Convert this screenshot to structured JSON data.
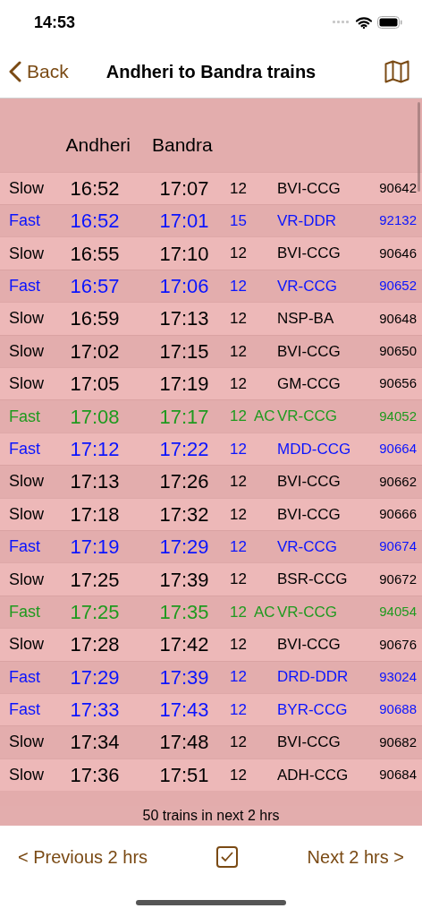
{
  "status_bar": {
    "time": "14:53"
  },
  "nav": {
    "back": "Back",
    "title": "Andheri to Bandra trains"
  },
  "table": {
    "columns": [
      "Andheri",
      "Bandra"
    ],
    "rows": [
      {
        "kind": "slow",
        "type": "Slow",
        "depart": "16:52",
        "arrive": "17:07",
        "cars": "12",
        "route": "BVI-CCG",
        "train": "90642"
      },
      {
        "kind": "fast",
        "type": "Fast",
        "depart": "16:52",
        "arrive": "17:01",
        "cars": "15",
        "route": "VR-DDR",
        "train": "92132"
      },
      {
        "kind": "slow",
        "type": "Slow",
        "depart": "16:55",
        "arrive": "17:10",
        "cars": "12",
        "route": "BVI-CCG",
        "train": "90646"
      },
      {
        "kind": "fast",
        "type": "Fast",
        "depart": "16:57",
        "arrive": "17:06",
        "cars": "12",
        "route": "VR-CCG",
        "train": "90652"
      },
      {
        "kind": "slow",
        "type": "Slow",
        "depart": "16:59",
        "arrive": "17:13",
        "cars": "12",
        "route": "NSP-BA",
        "train": "90648"
      },
      {
        "kind": "slow",
        "type": "Slow",
        "depart": "17:02",
        "arrive": "17:15",
        "cars": "12",
        "route": "BVI-CCG",
        "train": "90650"
      },
      {
        "kind": "slow",
        "type": "Slow",
        "depart": "17:05",
        "arrive": "17:19",
        "cars": "12",
        "route": "GM-CCG",
        "train": "90656"
      },
      {
        "kind": "ac",
        "type": "Fast",
        "depart": "17:08",
        "arrive": "17:17",
        "cars": "12",
        "ac": "AC",
        "route": "VR-CCG",
        "train": "94052"
      },
      {
        "kind": "fast",
        "type": "Fast",
        "depart": "17:12",
        "arrive": "17:22",
        "cars": "12",
        "route": "MDD-CCG",
        "train": "90664"
      },
      {
        "kind": "slow",
        "type": "Slow",
        "depart": "17:13",
        "arrive": "17:26",
        "cars": "12",
        "route": "BVI-CCG",
        "train": "90662"
      },
      {
        "kind": "slow",
        "type": "Slow",
        "depart": "17:18",
        "arrive": "17:32",
        "cars": "12",
        "route": "BVI-CCG",
        "train": "90666"
      },
      {
        "kind": "fast",
        "type": "Fast",
        "depart": "17:19",
        "arrive": "17:29",
        "cars": "12",
        "route": "VR-CCG",
        "train": "90674"
      },
      {
        "kind": "slow",
        "type": "Slow",
        "depart": "17:25",
        "arrive": "17:39",
        "cars": "12",
        "route": "BSR-CCG",
        "train": "90672"
      },
      {
        "kind": "ac",
        "type": "Fast",
        "depart": "17:25",
        "arrive": "17:35",
        "cars": "12",
        "ac": "AC",
        "route": "VR-CCG",
        "train": "94054"
      },
      {
        "kind": "slow",
        "type": "Slow",
        "depart": "17:28",
        "arrive": "17:42",
        "cars": "12",
        "route": "BVI-CCG",
        "train": "90676"
      },
      {
        "kind": "fast",
        "type": "Fast",
        "depart": "17:29",
        "arrive": "17:39",
        "cars": "12",
        "route": "DRD-DDR",
        "train": "93024"
      },
      {
        "kind": "fast",
        "type": "Fast",
        "depart": "17:33",
        "arrive": "17:43",
        "cars": "12",
        "route": "BYR-CCG",
        "train": "90688"
      },
      {
        "kind": "slow",
        "type": "Slow",
        "depart": "17:34",
        "arrive": "17:48",
        "cars": "12",
        "route": "BVI-CCG",
        "train": "90682"
      },
      {
        "kind": "slow",
        "type": "Slow",
        "depart": "17:36",
        "arrive": "17:51",
        "cars": "12",
        "route": "ADH-CCG",
        "train": "90684"
      }
    ],
    "count": "50 trains in next 2 hrs"
  },
  "toolbar": {
    "previous": "< Previous 2 hrs",
    "checkbox": {
      "checked": true
    },
    "next": "Next 2 hrs >"
  }
}
